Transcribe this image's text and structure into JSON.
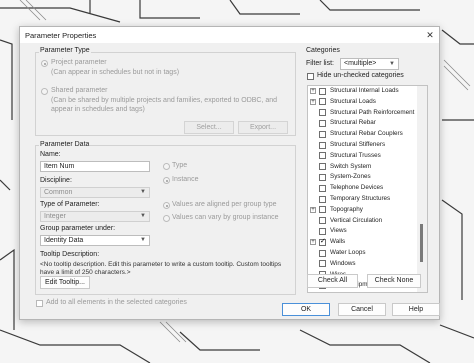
{
  "dialog": {
    "title": "Parameter Properties",
    "close_glyph": "✕"
  },
  "parameter_type": {
    "title": "Parameter Type",
    "project_label": "Project parameter",
    "project_desc": "(Can appear in schedules but not in tags)",
    "shared_label": "Shared parameter",
    "shared_desc_1": "(Can be shared by multiple projects and families, exported to ODBC, and",
    "shared_desc_2": "appear in schedules and tags)",
    "select_button": "Select...",
    "export_button": "Export..."
  },
  "parameter_data": {
    "title": "Parameter Data",
    "name_label": "Name:",
    "name_value": "Item Num",
    "type_option": "Type",
    "instance_option": "Instance",
    "discipline_label": "Discipline:",
    "discipline_value": "Common",
    "type_of_parameter_label": "Type of Parameter:",
    "type_of_parameter_value": "Integer",
    "aligned_option": "Values are aligned per group type",
    "vary_option": "Values can vary by group instance",
    "group_under_label": "Group parameter under:",
    "group_under_value": "Identity Data",
    "tooltip_label": "Tooltip Description:",
    "tooltip_text": "<No tooltip description. Edit this parameter to write a custom tooltip. Custom tooltips have a limit of 250 characters.>",
    "edit_tooltip_button": "Edit Tooltip..."
  },
  "add_all": {
    "label": "Add to all elements in the selected categories",
    "checked": false
  },
  "categories": {
    "title": "Categories",
    "filter_label": "Filter list:",
    "filter_value": "<multiple>",
    "hide_unchecked_label": "Hide un-checked categories",
    "items": [
      {
        "label": "Structural Internal Loads",
        "expander": "+",
        "checked": false
      },
      {
        "label": "Structural Loads",
        "expander": "+",
        "checked": false
      },
      {
        "label": "Structural Path Reinforcement",
        "expander": "",
        "checked": false
      },
      {
        "label": "Structural Rebar",
        "expander": "",
        "checked": false
      },
      {
        "label": "Structural Rebar Couplers",
        "expander": "",
        "checked": false
      },
      {
        "label": "Structural Stiffeners",
        "expander": "",
        "checked": false
      },
      {
        "label": "Structural Trusses",
        "expander": "",
        "checked": false
      },
      {
        "label": "Switch System",
        "expander": "",
        "checked": false
      },
      {
        "label": "System-Zones",
        "expander": "",
        "checked": false
      },
      {
        "label": "Telephone Devices",
        "expander": "",
        "checked": false
      },
      {
        "label": "Temporary Structures",
        "expander": "",
        "checked": false
      },
      {
        "label": "Topography",
        "expander": "+",
        "checked": false
      },
      {
        "label": "Vertical Circulation",
        "expander": "",
        "checked": false
      },
      {
        "label": "Views",
        "expander": "",
        "checked": false
      },
      {
        "label": "Walls",
        "expander": "+",
        "checked": true
      },
      {
        "label": "Water Loops",
        "expander": "",
        "checked": false
      },
      {
        "label": "Windows",
        "expander": "",
        "checked": false
      },
      {
        "label": "Wires",
        "expander": "",
        "checked": false
      },
      {
        "label": "Zone Equipment",
        "expander": "",
        "checked": false
      }
    ],
    "check_all_button": "Check All",
    "check_none_button": "Check None"
  },
  "footer": {
    "ok_button": "OK",
    "cancel_button": "Cancel",
    "help_button": "Help"
  },
  "colors": {
    "accent": "#4a90d9",
    "dialog_bg": "#f0f0f0",
    "disabled_text": "#9a9a9a"
  }
}
